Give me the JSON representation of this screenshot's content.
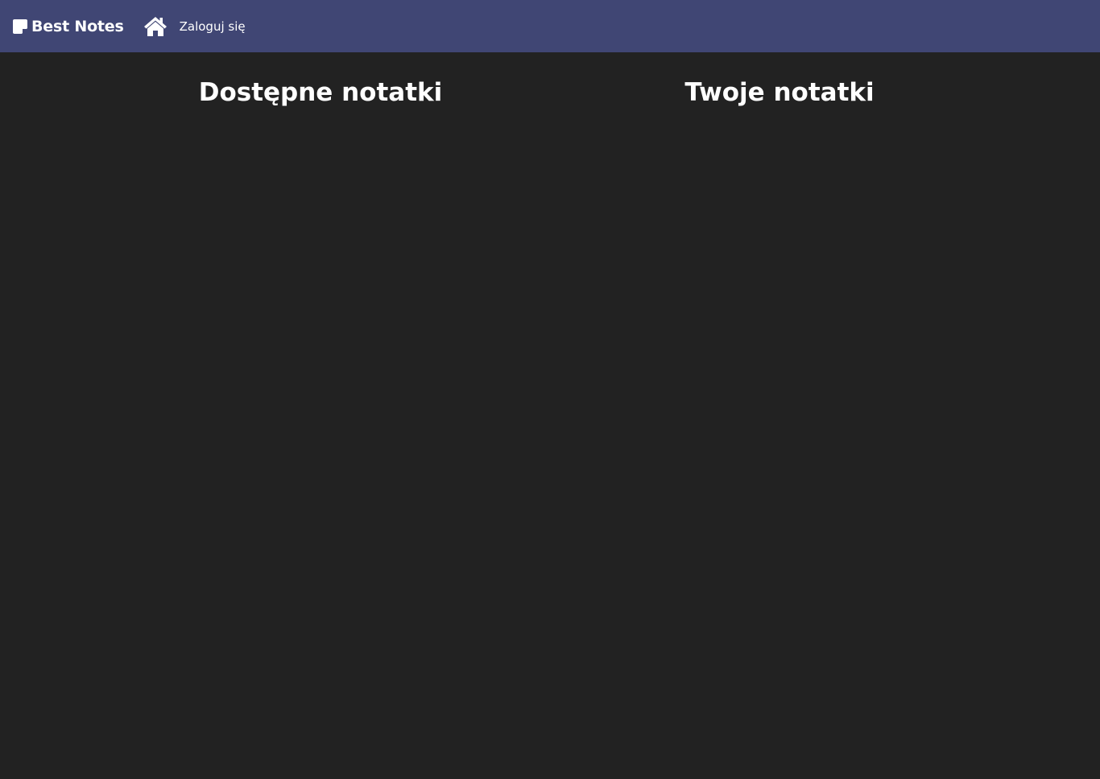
{
  "navbar": {
    "brand_label": "Best Notes",
    "brand_icon": "sticky-note-icon",
    "home_icon": "home-icon",
    "login_label": "Zaloguj się",
    "background": "#404674"
  },
  "main": {
    "available_notes_title": "Dostępne notatki",
    "your_notes_title": "Twoje notatki",
    "background": "#222222"
  }
}
